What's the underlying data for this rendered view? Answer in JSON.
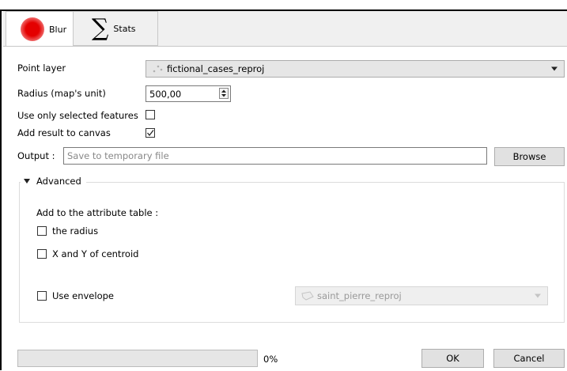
{
  "tabs": [
    {
      "label": "Blur"
    },
    {
      "label": "Stats"
    }
  ],
  "form": {
    "point_layer_label": "Point layer",
    "point_layer_value": "fictional_cases_reproj",
    "radius_label": "Radius (map's unit)",
    "radius_value": "500,00",
    "selected_features_label": "Use only selected features",
    "selected_features_checked": false,
    "add_result_label": "Add result to canvas",
    "add_result_checked": true,
    "output_label": "Output :",
    "output_placeholder": "Save to temporary file",
    "browse_label": "Browse"
  },
  "advanced": {
    "title": "Advanced",
    "add_to_table_label": "Add to the attribute table :",
    "radius_option": "the radius",
    "centroid_option": "X and Y of centroid",
    "envelope_label": "Use envelope",
    "envelope_layer": "saint_pierre_reproj"
  },
  "footer": {
    "progress": 0,
    "progress_text": "0%",
    "ok_label": "OK",
    "cancel_label": "Cancel"
  },
  "colors": {
    "blur_icon": "#e40000",
    "tab_bar": "#f0f0f0",
    "combo_bg": "#e6e6e6",
    "button_bg": "#e1e1e1"
  },
  "icons": {
    "blur_tab": "red-blur-dot-icon",
    "stats_tab": "sigma-icon",
    "point_layer": "point-layer-icon",
    "envelope_layer": "polygon-layer-icon"
  }
}
